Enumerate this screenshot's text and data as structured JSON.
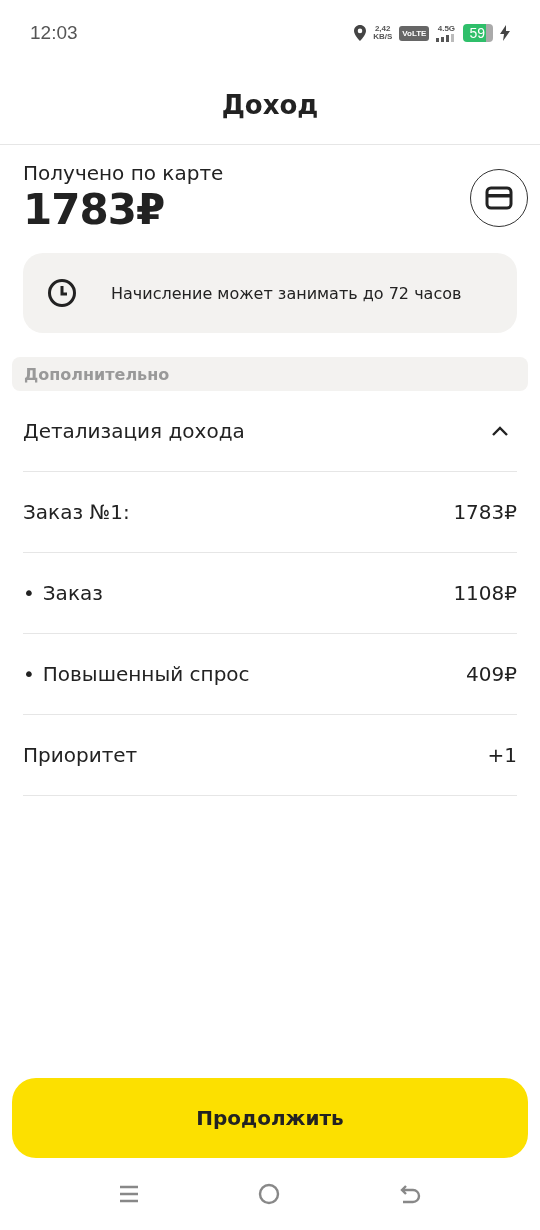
{
  "status_bar": {
    "time": "12:03",
    "speed_value": "2,42",
    "speed_unit": "KB/S",
    "volte": "VoLTE",
    "network": "4.5G",
    "battery": "59",
    "charging": true
  },
  "header": {
    "title": "Доход"
  },
  "summary": {
    "label": "Получено по карте",
    "amount": "1783₽"
  },
  "notice": {
    "text": "Начисление может занимать до 72 часов"
  },
  "section": {
    "label": "Дополнительно"
  },
  "details": {
    "title": "Детализация дохода",
    "expanded": true,
    "rows": [
      {
        "kind": "plain",
        "label": "Заказ №1:",
        "value": "1783₽"
      },
      {
        "kind": "bullet",
        "bullet": "•",
        "label": "Заказ",
        "value": "1108₽"
      },
      {
        "kind": "bullet",
        "bullet": "•",
        "label": "Повышенный спрос",
        "value": "409₽"
      },
      {
        "kind": "plain",
        "label": "Приоритет",
        "value": "+1"
      }
    ]
  },
  "button": {
    "label": "Продолжить"
  }
}
